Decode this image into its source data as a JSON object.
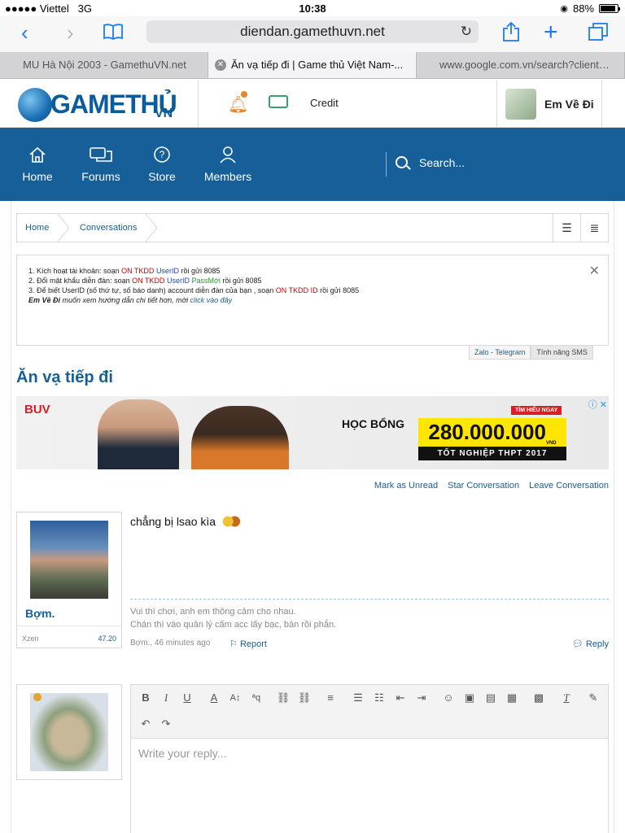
{
  "status_bar": {
    "carrier": "●●●●● Viettel",
    "network": "3G",
    "time": "10:38",
    "battery": "88%",
    "battery_level": 0.88
  },
  "browser": {
    "url": "diendan.gamethuvn.net",
    "tabs": [
      {
        "label": "MU Hà Nội 2003 - GamethuVN.net",
        "active": false
      },
      {
        "label": "Ăn vạ tiếp đi | Game thủ Việt Nam-...",
        "active": true
      },
      {
        "label": "www.google.com.vn/search?client=s...",
        "active": false
      }
    ]
  },
  "header": {
    "logo_text": "GAMETHỦ",
    "logo_suffix": "VN",
    "credit_label": "Credit",
    "username": "Em Về Đi"
  },
  "nav": {
    "items": [
      {
        "label": "Home",
        "icon": "home-icon"
      },
      {
        "label": "Forums",
        "icon": "chat-bubbles-icon"
      },
      {
        "label": "Store",
        "icon": "question-circle-icon"
      },
      {
        "label": "Members",
        "icon": "person-icon"
      }
    ],
    "search_placeholder": "Search..."
  },
  "breadcrumb": {
    "items": [
      "Home",
      "Conversations"
    ]
  },
  "notice": {
    "line1": {
      "prefix": "1. Kích hoạt tài khoản: soạn ",
      "cmd": "ON TKDD",
      "space": " ",
      "var": "UserID",
      "suffix": " rồi gửi 8085"
    },
    "line2": {
      "prefix": "2. Đổi mật khẩu diễn đàn: soạn ",
      "cmd": "ON TKDD",
      "space": " ",
      "var": "UserID",
      "space2": " ",
      "var2": "PassMới",
      "suffix": " rồi gửi 8085"
    },
    "line3": {
      "prefix": "3. Để biết UserID (số thứ tự, số báo danh) account diễn đàn của bạn , soạn ",
      "cmd": "ON TKDD ID",
      "suffix": " rồi gửi 8085"
    },
    "line4": {
      "user": "Em Về Đi",
      "text": " muốn xem hướng dẫn chi tiết hơn, mời ",
      "link": "click vào đây"
    },
    "tabs": [
      "Zalo - Telegram",
      "Tính năng SMS"
    ]
  },
  "page_title": "Ăn vạ tiếp đi",
  "ad": {
    "brand": "BUV",
    "badge": "TÌM HIỂU NGAY",
    "headline": "HỌC BỔNG",
    "amount": "280.000.000",
    "amount_unit": "VND",
    "subline": "TỐT NGHIỆP THPT 2017"
  },
  "conversation_actions": [
    "Mark as Unread",
    "Star Conversation",
    "Leave Conversation"
  ],
  "message": {
    "author": "Bợm.",
    "user_title": "Xzen",
    "user_stat": "47.20",
    "text": "chẳng bị lsao kìa",
    "signature_line1": "Vui thì chơi, anh em thông cảm cho nhau.",
    "signature_line2": "Chán thì vào quản lý cấm acc lấy bạc, bán rồi phắn.",
    "meta": "Bợm., 46 minutes ago",
    "report_label": "Report",
    "reply_label": "Reply"
  },
  "editor": {
    "placeholder": "Write your reply..."
  },
  "colors": {
    "brand_blue": "#165f98",
    "accent_orange": "#e8862a",
    "ad_yellow": "#ffe500"
  }
}
